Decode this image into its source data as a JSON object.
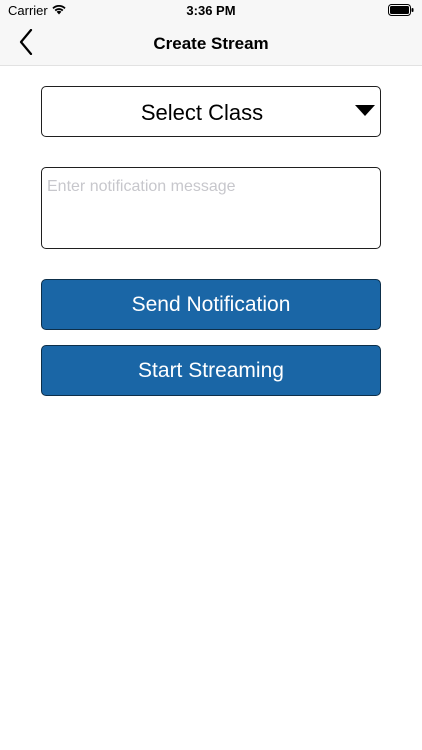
{
  "status_bar": {
    "carrier": "Carrier",
    "time": "3:36 PM",
    "icons": [
      "wifi-icon",
      "battery-icon"
    ]
  },
  "nav": {
    "title": "Create Stream",
    "back_icon": "chevron-left-icon"
  },
  "form": {
    "select_class": {
      "label": "Select Class",
      "icon": "caret-down-icon"
    },
    "message": {
      "value": "",
      "placeholder": "Enter notification message"
    },
    "send_label": "Send Notification",
    "stream_label": "Start Streaming"
  },
  "colors": {
    "accent": "#1a66a6",
    "nav_background": "#f7f7f7",
    "placeholder": "#c7c7cc"
  }
}
